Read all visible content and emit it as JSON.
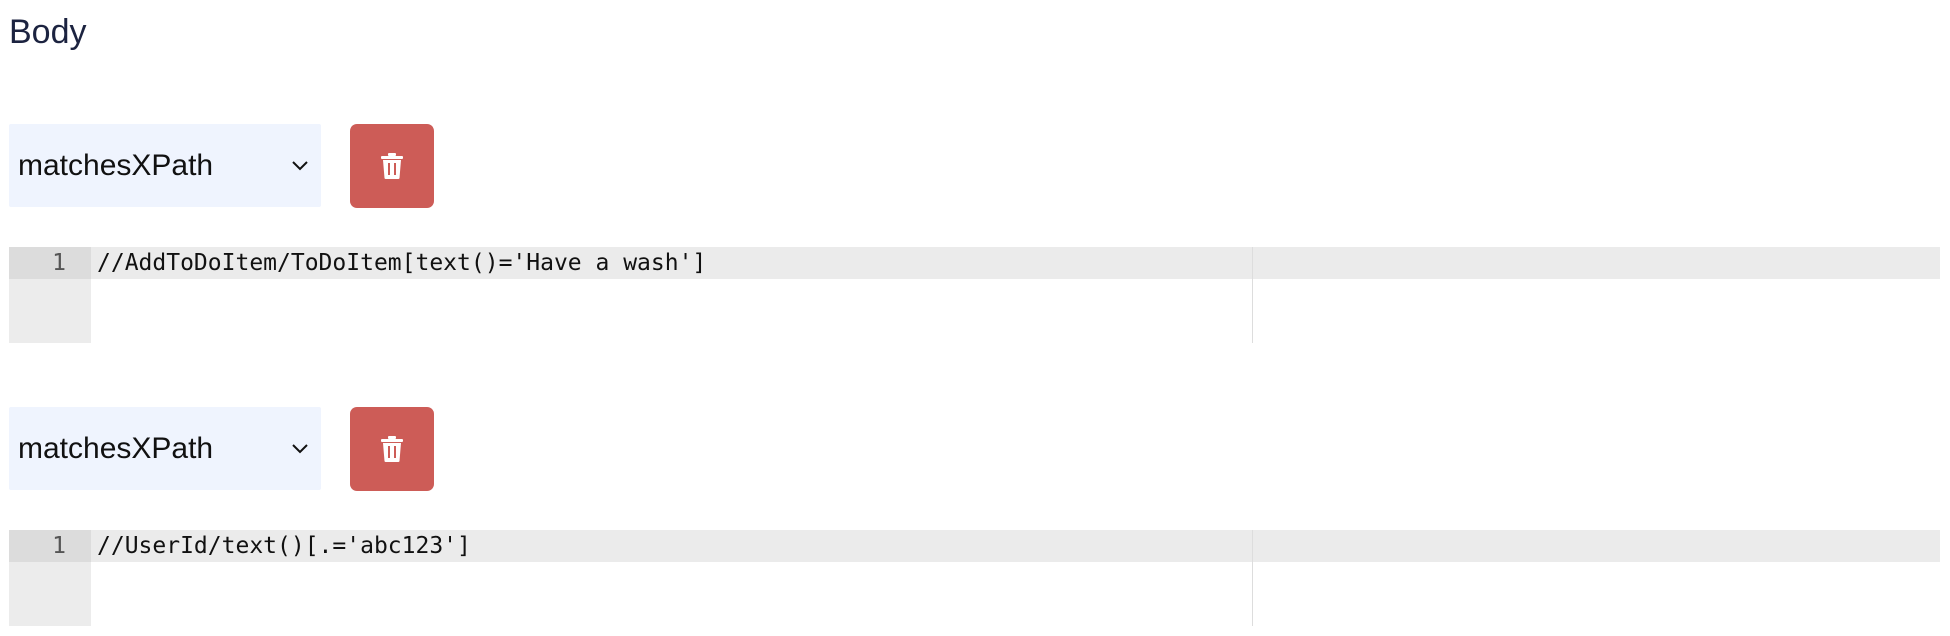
{
  "section": {
    "title": "Body"
  },
  "matchers": [
    {
      "type": "matchesXPath",
      "line_number": "1",
      "code": "//AddToDoItem/ToDoItem[text()='Have a wash']"
    },
    {
      "type": "matchesXPath",
      "line_number": "1",
      "code": "//UserId/text()[.='abc123']"
    }
  ],
  "icons": {
    "select_toggle": "chevron-down-icon",
    "delete": "trash-icon"
  },
  "colors": {
    "select_background": "#eff4fe",
    "delete_button": "#cd5c57",
    "editor_gutter": "#ececec",
    "active_line": "#ebebeb",
    "title_text": "#1c2340"
  }
}
